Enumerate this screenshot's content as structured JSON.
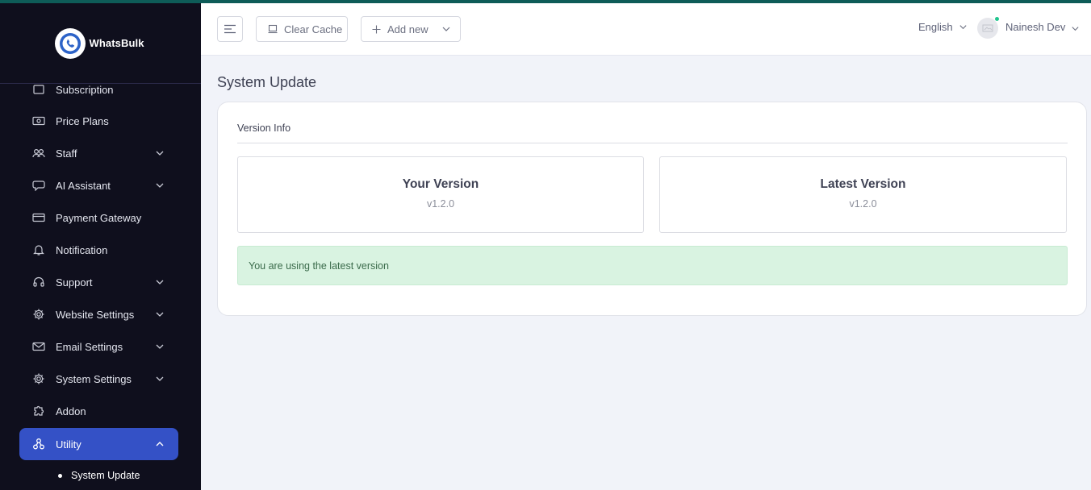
{
  "brand": {
    "name": "WhatsBulk"
  },
  "header": {
    "clear_cache": "Clear Cache",
    "add_new": "Add new",
    "language": "English",
    "user_name": "Nainesh Dev"
  },
  "sidebar": {
    "partial_item": "Subscription",
    "items": [
      {
        "label": "Price Plans",
        "icon": "price-tag-icon",
        "has_submenu": false
      },
      {
        "label": "Staff",
        "icon": "users-icon",
        "has_submenu": true
      },
      {
        "label": "AI Assistant",
        "icon": "chat-bubble-icon",
        "has_submenu": true
      },
      {
        "label": "Payment Gateway",
        "icon": "card-icon",
        "has_submenu": false
      },
      {
        "label": "Notification",
        "icon": "bell-icon",
        "has_submenu": false
      },
      {
        "label": "Support",
        "icon": "headset-icon",
        "has_submenu": true
      },
      {
        "label": "Website Settings",
        "icon": "gear-icon",
        "has_submenu": true
      },
      {
        "label": "Email Settings",
        "icon": "envelope-icon",
        "has_submenu": true
      },
      {
        "label": "System Settings",
        "icon": "gear-icon",
        "has_submenu": true
      },
      {
        "label": "Addon",
        "icon": "puzzle-icon",
        "has_submenu": false
      },
      {
        "label": "Utility",
        "icon": "nodes-icon",
        "has_submenu": true,
        "active": true
      }
    ],
    "sub_items": [
      {
        "label": "System Update",
        "active": true
      }
    ]
  },
  "main": {
    "page_title": "System Update",
    "card_title": "Version Info",
    "your_version_label": "Your Version",
    "your_version_value": "v1.2.0",
    "latest_version_label": "Latest Version",
    "latest_version_value": "v1.2.0",
    "alert_message": "You are using the latest version"
  },
  "colors": {
    "accent_bar": "#0e5c58",
    "sidebar_bg": "#0f0f1d",
    "active_item": "#3451c6",
    "alert_bg": "#d9f3e1",
    "online_dot": "#21c58e"
  }
}
